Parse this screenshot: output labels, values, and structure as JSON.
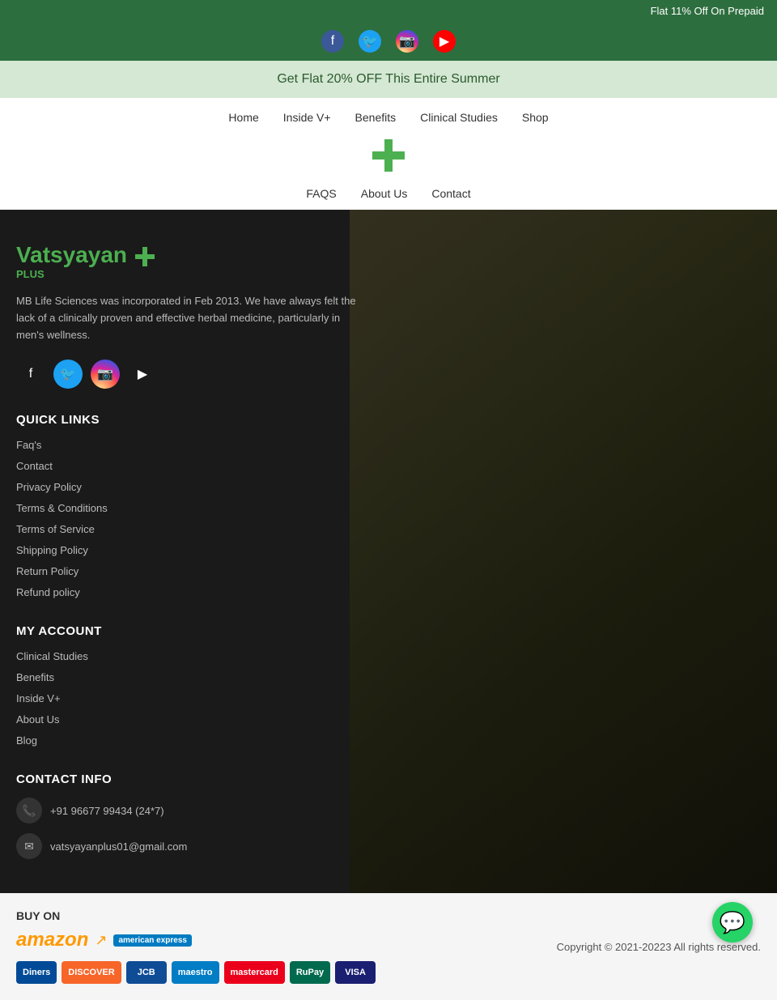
{
  "announcement": {
    "text": "Flat 11% Off On Prepaid"
  },
  "promo": {
    "text": "Get Flat 20% OFF This Entire Summer"
  },
  "nav": {
    "top_links": [
      "Home",
      "Inside V+",
      "Benefits",
      "Clinical Studies",
      "Shop"
    ],
    "bottom_links": [
      "FAQS",
      "About Us",
      "Contact"
    ]
  },
  "footer": {
    "logo": {
      "brand": "Vatsyayan",
      "plus": "PLUS"
    },
    "description": "MB Life Sciences was incorporated in Feb 2013. We have always felt the lack of a clinically proven and effective herbal medicine, particularly in men's wellness.",
    "quick_links_title": "QUICK LINKS",
    "quick_links": [
      {
        "label": "Faq's",
        "href": "#"
      },
      {
        "label": "Contact",
        "href": "#"
      },
      {
        "label": "Privacy Policy",
        "href": "#"
      },
      {
        "label": "Terms & Conditions",
        "href": "#"
      },
      {
        "label": "Terms of Service",
        "href": "#"
      },
      {
        "label": "Shipping Policy",
        "href": "#"
      },
      {
        "label": "Return Policy",
        "href": "#"
      },
      {
        "label": "Refund policy",
        "href": "#"
      }
    ],
    "my_account_title": "MY ACCOUNT",
    "my_account_links": [
      {
        "label": "Clinical Studies",
        "href": "#"
      },
      {
        "label": "Benefits",
        "href": "#"
      },
      {
        "label": "Inside V+",
        "href": "#"
      },
      {
        "label": "About Us",
        "href": "#"
      },
      {
        "label": "Blog",
        "href": "#"
      }
    ],
    "contact_title": "CONTACT INFO",
    "phone": "+91 96677 99434 (24*7)",
    "email": "vatsyayanplus01@gmail.com"
  },
  "bottom": {
    "buy_on": "BUY ON",
    "copyright": "Copyright © 2021-20223 All rights reserved.",
    "payment_methods": [
      "Diners",
      "Discover",
      "JCB",
      "Maestro",
      "Mastercard",
      "RuPay",
      "Visa"
    ]
  },
  "social": {
    "facebook_icon": "f",
    "twitter_icon": "t",
    "instagram_icon": "◎",
    "youtube_icon": "▶"
  }
}
